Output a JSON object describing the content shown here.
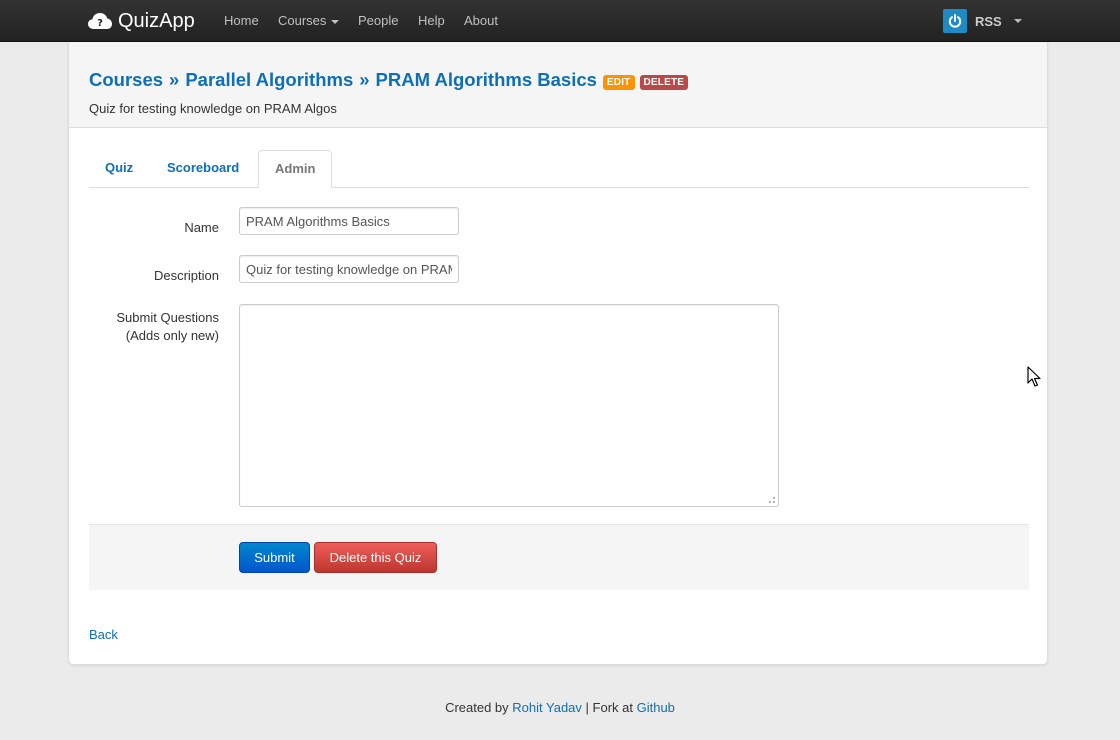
{
  "navbar": {
    "brand": "QuizApp",
    "items": [
      {
        "label": "Home"
      },
      {
        "label": "Courses",
        "dropdown": true
      },
      {
        "label": "People"
      },
      {
        "label": "Help"
      },
      {
        "label": "About"
      }
    ],
    "user": {
      "name": "RSS",
      "icon": "power-icon"
    }
  },
  "breadcrumb": {
    "courses": "Courses",
    "separator": "»",
    "course": "Parallel Algorithms",
    "quiz": "PRAM Algorithms Basics",
    "edit_badge": "EDIT",
    "delete_badge": "DELETE"
  },
  "subtitle": "Quiz for testing knowledge on PRAM Algos",
  "tabs": [
    {
      "label": "Quiz",
      "active": false
    },
    {
      "label": "Scoreboard",
      "active": false
    },
    {
      "label": "Admin",
      "active": true
    }
  ],
  "form": {
    "name_label": "Name",
    "name_value": "PRAM Algorithms Basics",
    "description_label": "Description",
    "description_value": "Quiz for testing knowledge on PRAM Algos",
    "questions_label_line1": "Submit Questions",
    "questions_label_line2": "(Adds only new)",
    "questions_value": "",
    "submit_label": "Submit",
    "delete_label": "Delete this Quiz"
  },
  "back_link": "Back",
  "footer": {
    "prefix": "Created by",
    "author": "Rohit Yadav",
    "middle": "| Fork at",
    "repo": "Github"
  },
  "colors": {
    "link": "#0d6fb8",
    "navbar": "#222222",
    "edit_badge": "#f89406",
    "delete_badge": "#b94a48",
    "primary_button": "#0074cc",
    "danger_button": "#da4f49"
  }
}
